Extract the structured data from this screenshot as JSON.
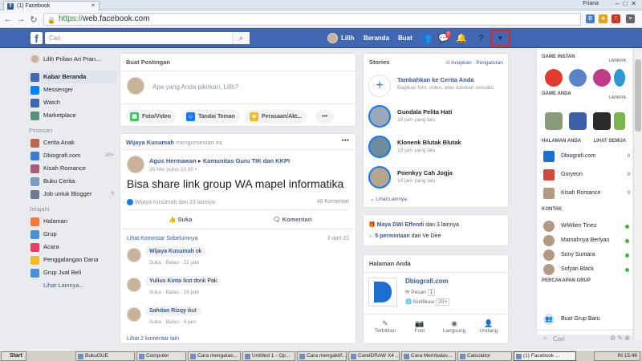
{
  "browser": {
    "tab_title": "(1) Facebook",
    "url_scheme": "https://",
    "url_host": "web.facebook.com",
    "profile_name": "Friana"
  },
  "topbar": {
    "search_placeholder": "Cari",
    "profile_name": "Lilih",
    "home_label": "Beranda",
    "create_label": "Buat",
    "messages_badge": "3"
  },
  "left_nav": {
    "profile": "Lilih Prilian Ari Pran...",
    "main": [
      {
        "label": "Kabar Beranda",
        "icon": "news-feed-icon",
        "color": "#4267b2",
        "selected": true
      },
      {
        "label": "Messenger",
        "icon": "messenger-icon",
        "color": "#0084ff"
      },
      {
        "label": "Watch",
        "icon": "watch-icon",
        "color": "#4267b2"
      },
      {
        "label": "Marketplace",
        "icon": "marketplace-icon",
        "color": "#5b8e7d"
      }
    ],
    "shortcuts_heading": "Pintasan",
    "shortcuts": [
      {
        "label": "Cerita Anak",
        "count": "",
        "color": "#b76b4a"
      },
      {
        "label": "Dbiografi.com",
        "count": "20+",
        "color": "#3b7bd5"
      },
      {
        "label": "Kisah Romance",
        "count": "",
        "color": "#a85b7a"
      },
      {
        "label": "Buku Cerita",
        "count": "",
        "color": "#7a9bc4"
      },
      {
        "label": "Job untuk Blogger",
        "count": "9",
        "color": "#6b7c8f"
      }
    ],
    "explore_heading": "Jelajahi",
    "explore": [
      {
        "label": "Halaman",
        "icon": "flag-icon",
        "color": "#f5793a"
      },
      {
        "label": "Grup",
        "icon": "group-icon",
        "color": "#4a90d9"
      },
      {
        "label": "Acara",
        "icon": "calendar-icon",
        "color": "#e4405f"
      },
      {
        "label": "Penggalangan Dana",
        "icon": "fundraiser-icon",
        "color": "#f7b928"
      },
      {
        "label": "Grup Jual Beli",
        "icon": "buy-sell-icon",
        "color": "#4a90d9"
      }
    ],
    "see_more": "Lihat Lainnya..."
  },
  "composer": {
    "heading": "Buat Postingan",
    "placeholder": "Apa yang Anda pikirkan, Lilih?",
    "actions": [
      "Foto/Video",
      "Tandai Teman",
      "Perasaan/Akt..."
    ],
    "more": "•••"
  },
  "post": {
    "sharer": "Wijaya Kusumah",
    "sharer_action": "mengomentari ini.",
    "author": "Agus Hermawan",
    "group": "Komunitas Guru TIK dan KKPI",
    "time": "26 Mei pukul 23.00",
    "text": "Bisa share link group WA mapel informatika",
    "reactions": "Wijaya Kusumah dan 23 lainnya",
    "comments_count": "48 Komentar",
    "like_label": "Suka",
    "comment_label": "Komentari",
    "prev_comments": "Lihat Komentar Sebelumnya",
    "prev_count": "3 dari 22",
    "comments": [
      {
        "name": "Wijaya Kusumah",
        "text": "ok",
        "meta": "Suka · Balas · 22 jam"
      },
      {
        "name": "Yulius Kinta",
        "text": "Ikut donk Pak",
        "meta": "Suka · Balas · 19 jam"
      },
      {
        "name": "Sahdan Rizqy",
        "text": "ikut",
        "meta": "Suka · Balas · 4 jam"
      }
    ],
    "more_replies": "Lihat 2 komentar lain"
  },
  "stories": {
    "heading": "Stories",
    "archive": "Arsipkan",
    "settings": "Pengaturan",
    "add_title": "Tambahkan ke Cerita Anda",
    "add_sub": "Bagikan foto, video, atau tuliskan sesuatu",
    "items": [
      {
        "name": "Gundala Pelita Hati",
        "time": "19 jam yang lalu"
      },
      {
        "name": "Klonenk Blutak Blutak",
        "time": "19 jam yang lalu"
      },
      {
        "name": "Poenkyy Cah Jogja",
        "time": "19 jam yang lalu"
      }
    ],
    "see_more": "Lihat Lainnya"
  },
  "birthdays": {
    "line1_name": "Maya DWi Effendi",
    "line1_rest": "dan 3 lainnya",
    "line2_bold": "5 permintaan",
    "line2_rest": "dari Ve Dee"
  },
  "your_pages": {
    "heading": "Halaman Anda",
    "page_name": "Dbiografi.com",
    "messages": "Pesan",
    "messages_count": "1",
    "notifications": "Notifikasi",
    "notifications_count": "20+",
    "actions": [
      "Terbitkan",
      "Foto",
      "Langsung",
      "Undang"
    ]
  },
  "right_rail": {
    "instant_games": "GAME INSTAN",
    "more": "LAINNYA",
    "your_games": "GAME ANDA",
    "pages_heading": "HALAMAN ANDA",
    "see_all": "LIHAT SEMUA",
    "pages": [
      {
        "name": "Dbiografi.com",
        "count": "9"
      },
      {
        "name": "Goryeon",
        "count": "9"
      },
      {
        "name": "Kisah Romance",
        "count": "9"
      }
    ],
    "contacts_heading": "KONTAK",
    "contacts": [
      "WiWlien Tinez",
      "Mamahnya Berlyan",
      "Sony Sumara",
      "Sofyan Black"
    ],
    "group_chat_heading": "PERCAKAPAN GRUP",
    "create_group": "Buat Grup Baru",
    "search_placeholder": "Cari"
  },
  "taskbar": {
    "start": "Start",
    "items": [
      "BukuGUE",
      "Computer",
      "Cara mengatas...",
      "Untitled 1 - Op...",
      "Cara mengaktif...",
      "CorelDRAW X4 ...",
      "Cara Membalas...",
      "Calculator",
      "(1) Facebook ..."
    ],
    "lang": "IN",
    "clock": "15:46"
  }
}
